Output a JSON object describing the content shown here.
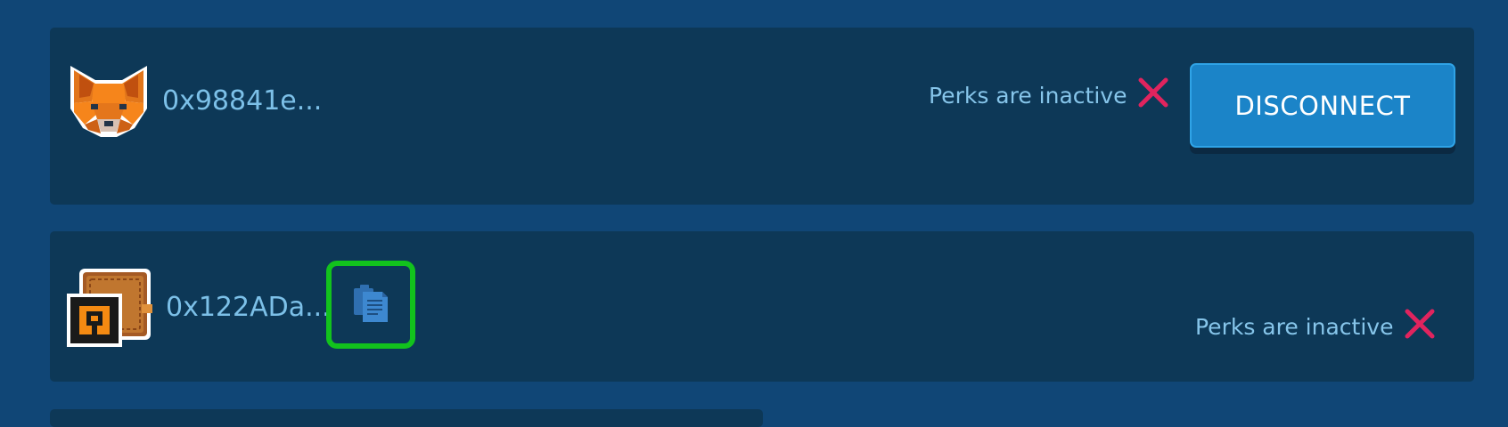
{
  "wallets": [
    {
      "avatar_icon": "metamask-fox-icon",
      "address": "0x98841e...",
      "perks_status": "Perks are inactive",
      "status_icon": "inactive-x-icon",
      "action_label": "DISCONNECT"
    },
    {
      "avatar_icon": "wallet-icon",
      "address": "0x122ADa...",
      "copy_icon": "copy-icon",
      "perks_status": "Perks are inactive",
      "status_icon": "inactive-x-icon"
    }
  ],
  "colors": {
    "background": "#104676",
    "panel": "#0d3857",
    "address_text": "#7cc0e8",
    "button": "#1b84c8",
    "inactive_x": "#e0245e",
    "copy_highlight": "#12c21d"
  }
}
